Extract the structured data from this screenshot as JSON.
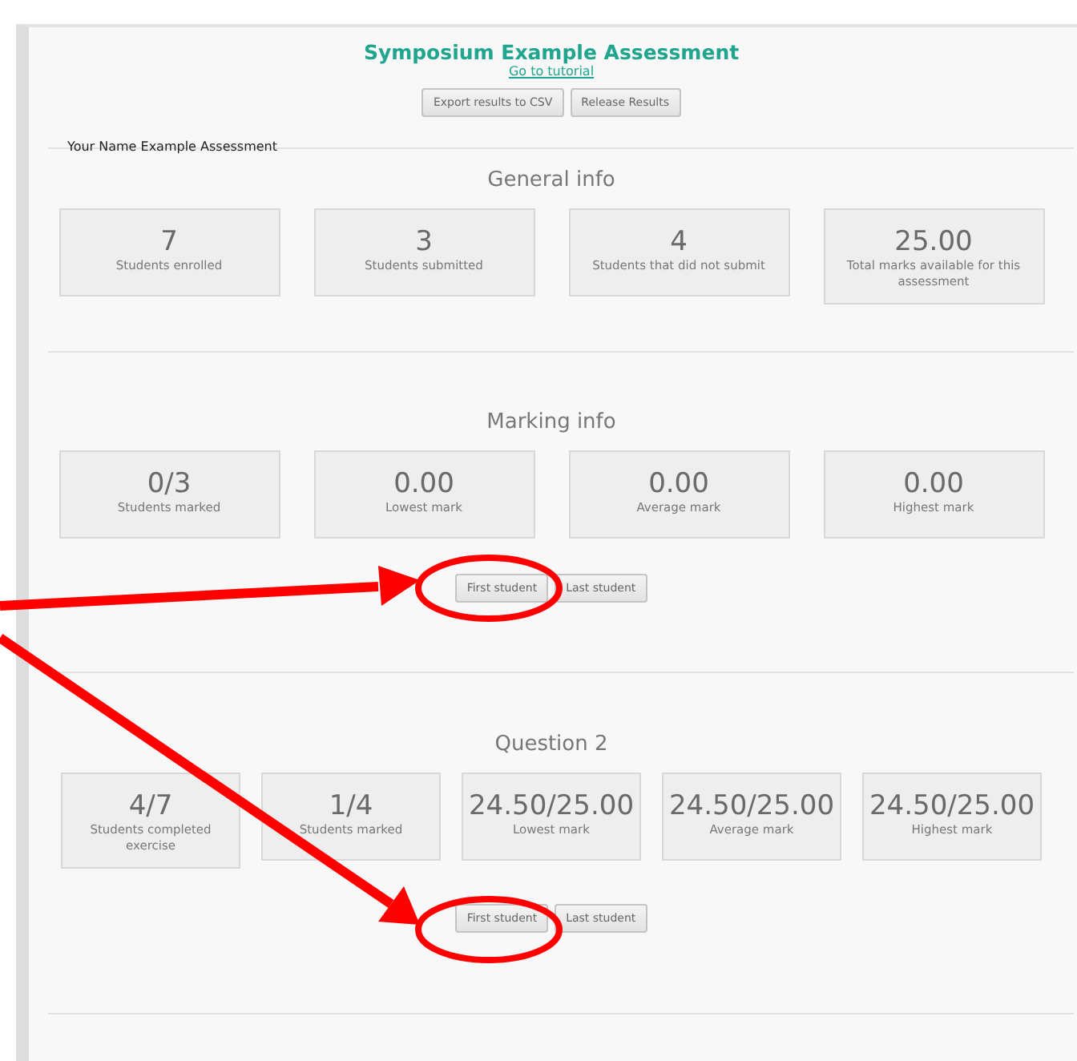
{
  "header": {
    "title": "Symposium Example Assessment",
    "link": "Go to tutorial",
    "buttons": [
      "Export results to CSV",
      "Release Results"
    ]
  },
  "assessment_label": "Your Name Example Assessment",
  "sections": [
    {
      "title": "General info",
      "stats": [
        {
          "value": "7",
          "label": "Students enrolled"
        },
        {
          "value": "3",
          "label": "Students submitted"
        },
        {
          "value": "4",
          "label": "Students that did not submit"
        },
        {
          "value": "25.00",
          "label": "Total marks available for this assessment"
        }
      ]
    },
    {
      "title": "Marking info",
      "stats": [
        {
          "value": "0/3",
          "label": "Students marked"
        },
        {
          "value": "0.00",
          "label": "Lowest mark"
        },
        {
          "value": "0.00",
          "label": "Average mark"
        },
        {
          "value": "0.00",
          "label": "Highest mark"
        }
      ],
      "buttons": [
        "First student",
        "Last student"
      ]
    },
    {
      "title": "Question 2",
      "stats": [
        {
          "value": "4/7",
          "label": "Students completed exercise"
        },
        {
          "value": "1/4",
          "label": "Students marked"
        },
        {
          "value": "24.50/25.00",
          "label": "Lowest mark"
        },
        {
          "value": "24.50/25.00",
          "label": "Average mark"
        },
        {
          "value": "24.50/25.00",
          "label": "Highest mark"
        }
      ],
      "buttons": [
        "First student",
        "Last student"
      ]
    }
  ]
}
